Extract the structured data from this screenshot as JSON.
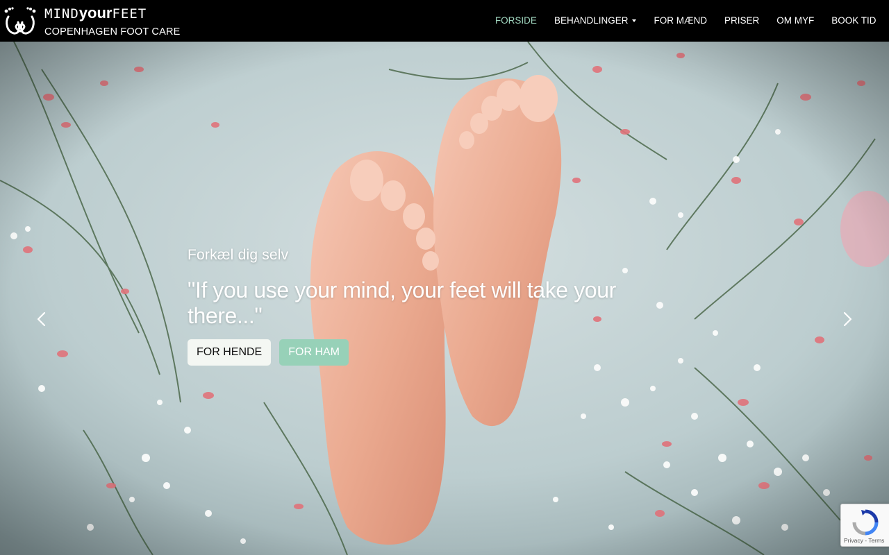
{
  "brand": {
    "name_part1": "MIND",
    "name_part2": "your",
    "name_part3": "FEET",
    "tagline": "COPENHAGEN FOOT CARE"
  },
  "nav": {
    "items": [
      {
        "label": "FORSIDE",
        "active": true
      },
      {
        "label": "BEHANDLINGER",
        "dropdown": true
      },
      {
        "label": "FOR MÆND"
      },
      {
        "label": "PRISER"
      },
      {
        "label": "OM MYF"
      },
      {
        "label": "BOOK TID"
      }
    ]
  },
  "hero": {
    "subtitle": "Forkæl dig selv",
    "quote": "\"If you use your mind, your feet will take your there...\"",
    "buttons": {
      "her": "FOR HENDE",
      "him": "FOR HAM"
    }
  },
  "recaptcha": {
    "links": "Privacy - Terms"
  },
  "colors": {
    "nav_bg": "#000000",
    "nav_active": "#9fd4bd",
    "btn_light": "#f4f7f3",
    "btn_green": "#97d1b8"
  },
  "icons": [
    "feet-logo-icon",
    "chevron-left-icon",
    "chevron-right-icon",
    "dropdown-caret-icon",
    "recaptcha-icon"
  ]
}
